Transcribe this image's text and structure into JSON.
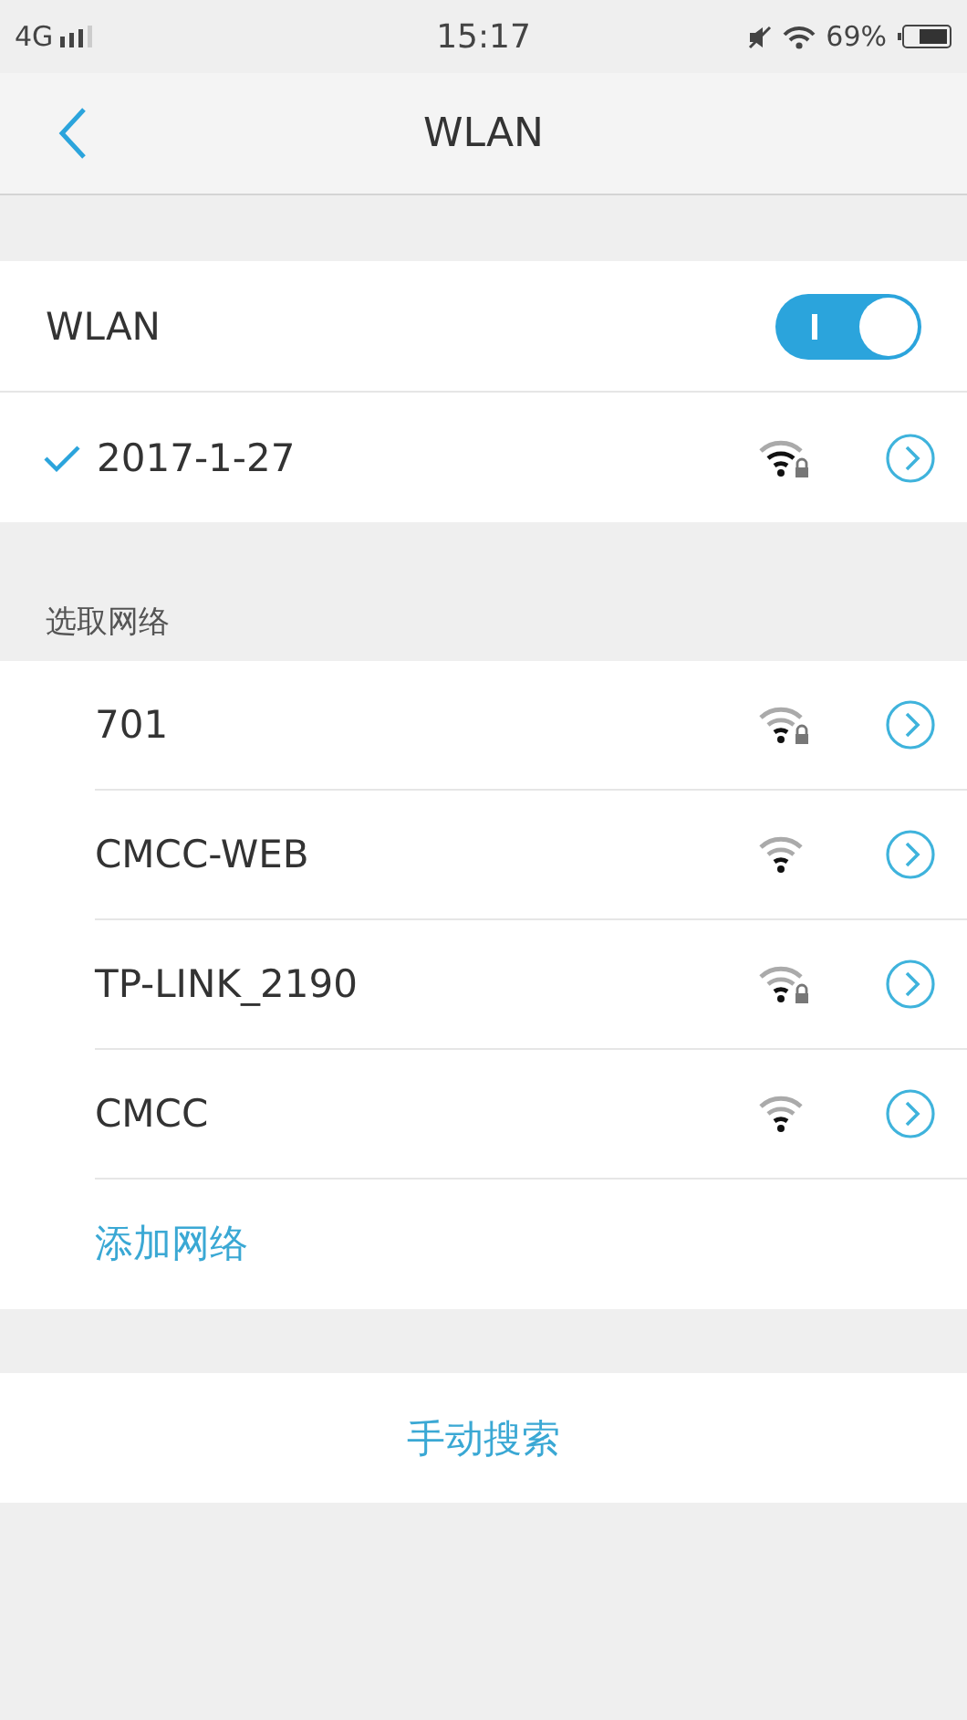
{
  "status_bar": {
    "network": "4G",
    "time": "15:17",
    "battery": "69%"
  },
  "nav": {
    "title": "WLAN"
  },
  "wlan": {
    "label": "WLAN",
    "on": true
  },
  "current": {
    "name": "2017-1-27",
    "connected": true,
    "locked": true
  },
  "section_label": "选取网络",
  "networks": [
    {
      "name": "701",
      "locked": true
    },
    {
      "name": "CMCC-WEB",
      "locked": false
    },
    {
      "name": "TP-LINK_2190",
      "locked": true
    },
    {
      "name": "CMCC",
      "locked": false
    }
  ],
  "add_network": "添加网络",
  "manual_search": "手动搜索"
}
